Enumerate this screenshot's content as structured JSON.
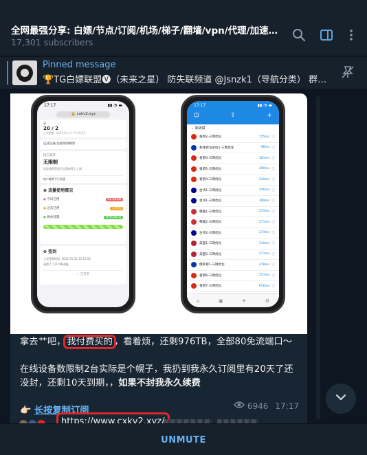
{
  "header": {
    "title": "全网最强分享: 白嫖/节点/订阅/机场/梯子/翻墙/vpn/代理/加速器/科…",
    "subscribers": "17,301 subscribers"
  },
  "pinned": {
    "label": "Pinned message",
    "text": "🏆TG白嫖联盟🅥（未来之星） 防失联频道 @Jsnzk1（导航分类） 群…"
  },
  "message": {
    "line1_pre": "拿去艹吧，",
    "line1_highlight": "我付费买的",
    "line1_post": "，看着烦，还剩976TB，全部80免流端口～",
    "para2_normal": "在线设备数限制2台实际是个幌子，我扔到我永久订阅里有20天了还没封，还剩10天到期，，",
    "para2_bold": "如果不封我永久续费",
    "link_icon": "👉🏻",
    "link_text": "长按复制订阅",
    "views": "6946",
    "time": "17:17"
  },
  "comment": {
    "url": "https://www.cxkv2.xyz/"
  },
  "bottom": {
    "unmute": "UNMUTE"
  },
  "phone_left": {
    "time": "17:17",
    "url": "cxkv2.xyz",
    "plan": "20 / 2",
    "plan_sub": "上次更新: 2022-01-11 17:16:12",
    "btn1": "应成设备/设备限制刷新",
    "card_label": "接口速率",
    "card_value": "无限制",
    "card_sub": "实际速率受限于运营商等之上限",
    "card_foot": "帐户最常下行网速",
    "usage_title": "流量使用情况",
    "usage1": "今日已用",
    "usage1_val": "61.48GB",
    "usage2": "过去已用",
    "usage2_val": "1.9TB",
    "usage3": "剩余流量",
    "usage3_val": "976.26TB",
    "signin_title": "签到",
    "signin_line1": "上次签到时间: 2022-01-22 10:10:52",
    "signin_line2": "获得了 111 MB流量。",
    "signin_btn": "已签到"
  },
  "phone_right": {
    "time": "17:17",
    "group": "新故障",
    "nodes": [
      {
        "name": "香港2-三网优化",
        "ms": "155ms",
        "flag": "#de2910"
      },
      {
        "name": "菲律宾马尼拉1-三网优化",
        "ms": "98ms",
        "flag": "#0038a8"
      },
      {
        "name": "香港3-三网优化",
        "ms": "181ms",
        "flag": "#de2910"
      },
      {
        "name": "香港5-三网优化",
        "ms": "200ms",
        "flag": "#de2910"
      },
      {
        "name": "香港4-三网优化",
        "ms": "220ms",
        "flag": "#de2910"
      },
      {
        "name": "台湾1-三网优化",
        "ms": "256ms",
        "flag": "#000095"
      },
      {
        "name": "台湾1-三网优化",
        "ms": "269ms",
        "flag": "#000095"
      },
      {
        "name": "韩国1-三网优化",
        "ms": "231ms",
        "flag": "#cd2e3a"
      },
      {
        "name": "韩国2-三网优化",
        "ms": "271ms",
        "flag": "#cd2e3a"
      },
      {
        "name": "台湾2-三网优化",
        "ms": "274ms",
        "flag": "#000095"
      },
      {
        "name": "美国1-三网优化",
        "ms": "310ms",
        "flag": "#b22234"
      },
      {
        "name": "美国2-三网优化",
        "ms": "471ms",
        "flag": "#b22234"
      },
      {
        "name": "俄罗斯1-三网优化",
        "ms": "478ms",
        "flag": "#0039a6"
      },
      {
        "name": "香港6-三网优化",
        "ms": "551ms",
        "flag": "#de2910"
      },
      {
        "name": "香港7-三网优化",
        "ms": "656ms",
        "flag": "#de2910"
      }
    ]
  },
  "colors": {
    "bg": "#0e1621",
    "panel": "#17212b",
    "bubble": "#182533",
    "accent": "#6ab3f3",
    "highlight_outline": "#e0282c"
  },
  "icons": [
    "search-icon",
    "sidebar-toggle-icon",
    "more-vert-icon",
    "unpin-icon",
    "eye-icon",
    "chevron-down-icon"
  ]
}
